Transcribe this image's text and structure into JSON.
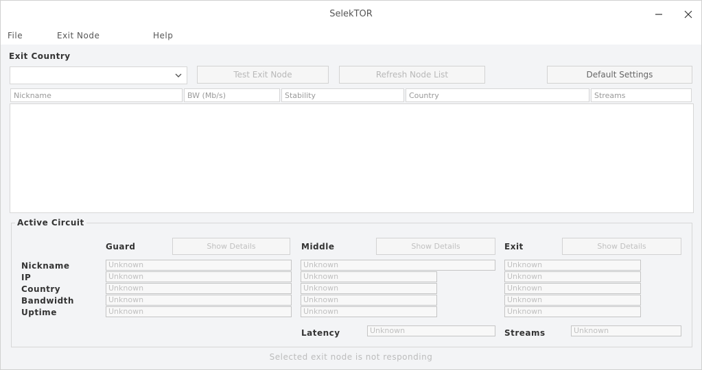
{
  "window": {
    "title": "SelekTOR"
  },
  "menu": {
    "items": [
      {
        "label": "File"
      },
      {
        "label": "Exit Node"
      },
      {
        "label": "Help"
      }
    ]
  },
  "selection": {
    "heading": "Exit Country",
    "country_value": "",
    "btn_test_exit": "Test Exit Node",
    "btn_refresh_list": "Refresh Node List",
    "btn_default_settings": "Default Settings"
  },
  "table": {
    "headers": [
      "Nickname",
      "BW (Mb/s)",
      "Stability",
      "Country",
      "Streams"
    ]
  },
  "circuit": {
    "title": "Active Circuit",
    "columns": [
      {
        "label": "Guard",
        "btn": "Show Details"
      },
      {
        "label": "Middle",
        "btn": "Show Details"
      },
      {
        "label": "Exit",
        "btn": "Show Details"
      }
    ],
    "row_labels": [
      "Nickname",
      "IP",
      "Country",
      "Bandwidth",
      "Uptime"
    ],
    "placeholder": "Unknown",
    "latency_label": "Latency",
    "latency_value": "Unknown",
    "streams_label": "Streams",
    "streams_value": "Unknown"
  },
  "status": {
    "text": "Selected exit node is not responding"
  }
}
